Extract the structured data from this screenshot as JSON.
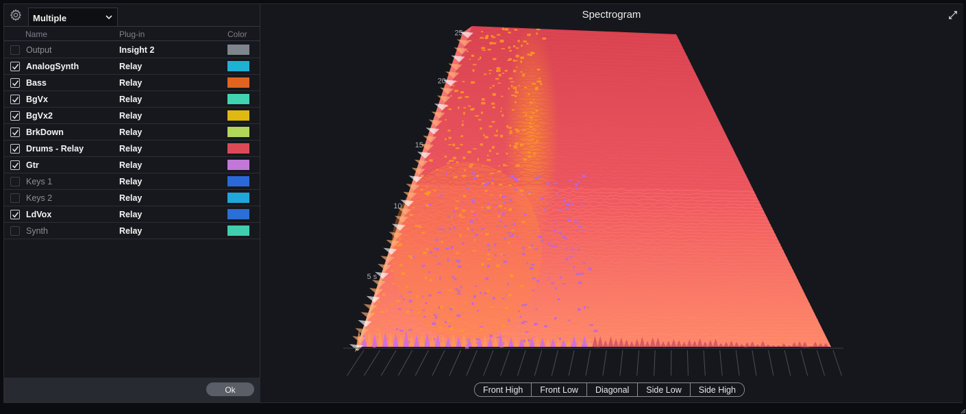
{
  "selector": {
    "value": "Multiple"
  },
  "columns": {
    "name": "Name",
    "plugin": "Plug-in",
    "color": "Color"
  },
  "tracks": [
    {
      "name": "Output",
      "plugin": "Insight 2",
      "checked": false,
      "color": "#7f858d"
    },
    {
      "name": "AnalogSynth",
      "plugin": "Relay",
      "checked": true,
      "color": "#1fb0d6"
    },
    {
      "name": "Bass",
      "plugin": "Relay",
      "checked": true,
      "color": "#e0641f"
    },
    {
      "name": "BgVx",
      "plugin": "Relay",
      "checked": true,
      "color": "#40d4b2"
    },
    {
      "name": "BgVx2",
      "plugin": "Relay",
      "checked": true,
      "color": "#e0b812"
    },
    {
      "name": "BrkDown",
      "plugin": "Relay",
      "checked": true,
      "color": "#b2d65a"
    },
    {
      "name": "Drums - Relay",
      "plugin": "Relay",
      "checked": true,
      "color": "#dc4a56"
    },
    {
      "name": "Gtr",
      "plugin": "Relay",
      "checked": true,
      "color": "#c278d8"
    },
    {
      "name": "Keys 1",
      "plugin": "Relay",
      "checked": false,
      "color": "#2a68d8"
    },
    {
      "name": "Keys 2",
      "plugin": "Relay",
      "checked": false,
      "color": "#22a6d8"
    },
    {
      "name": "LdVox",
      "plugin": "Relay",
      "checked": true,
      "color": "#2a6ed6"
    },
    {
      "name": "Synth",
      "plugin": "Relay",
      "checked": false,
      "color": "#3ed0ae"
    }
  ],
  "ok_label": "Ok",
  "spectrogram": {
    "title": "Spectrogram",
    "time_ticks": [
      "25",
      "20",
      "15",
      "10",
      "5 s"
    ],
    "surface_colors": {
      "back": "#d8414f",
      "front": "#ff8c5a",
      "orange": "#ff9a26",
      "purple": "#b466f0"
    }
  },
  "view_buttons": [
    "Front High",
    "Front Low",
    "Diagonal",
    "Side Low",
    "Side High"
  ]
}
